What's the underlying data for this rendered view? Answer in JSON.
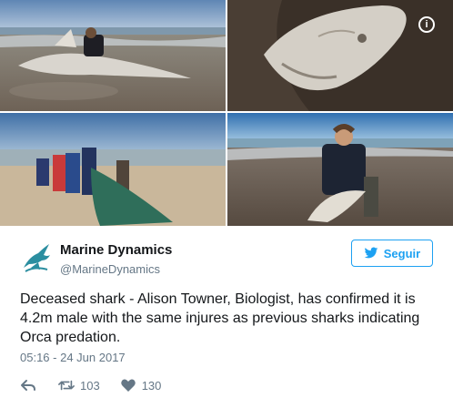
{
  "account": {
    "display_name": "Marine Dynamics",
    "handle": "@MarineDynamics"
  },
  "follow_button": {
    "label": "Seguir",
    "icon": "twitter-bird-icon"
  },
  "tweet": {
    "text": "Deceased shark - Alison Towner, Biologist, has confirmed it is 4.2m male with the same injures as previous sharks indicating Orca predation.",
    "timestamp": "05:16 - 24 Jun 2017"
  },
  "actions": {
    "reply_icon": "reply-icon",
    "retweet_icon": "retweet-icon",
    "retweet_count": "103",
    "like_icon": "heart-icon",
    "like_count": "130"
  },
  "media": {
    "photo_count": 4,
    "info_icon": "info-icon",
    "info_glyph": "i"
  },
  "colors": {
    "accent": "#1da1f2",
    "text": "#14171a",
    "secondary": "#657786",
    "avatar_teal": "#2b8ea0"
  }
}
